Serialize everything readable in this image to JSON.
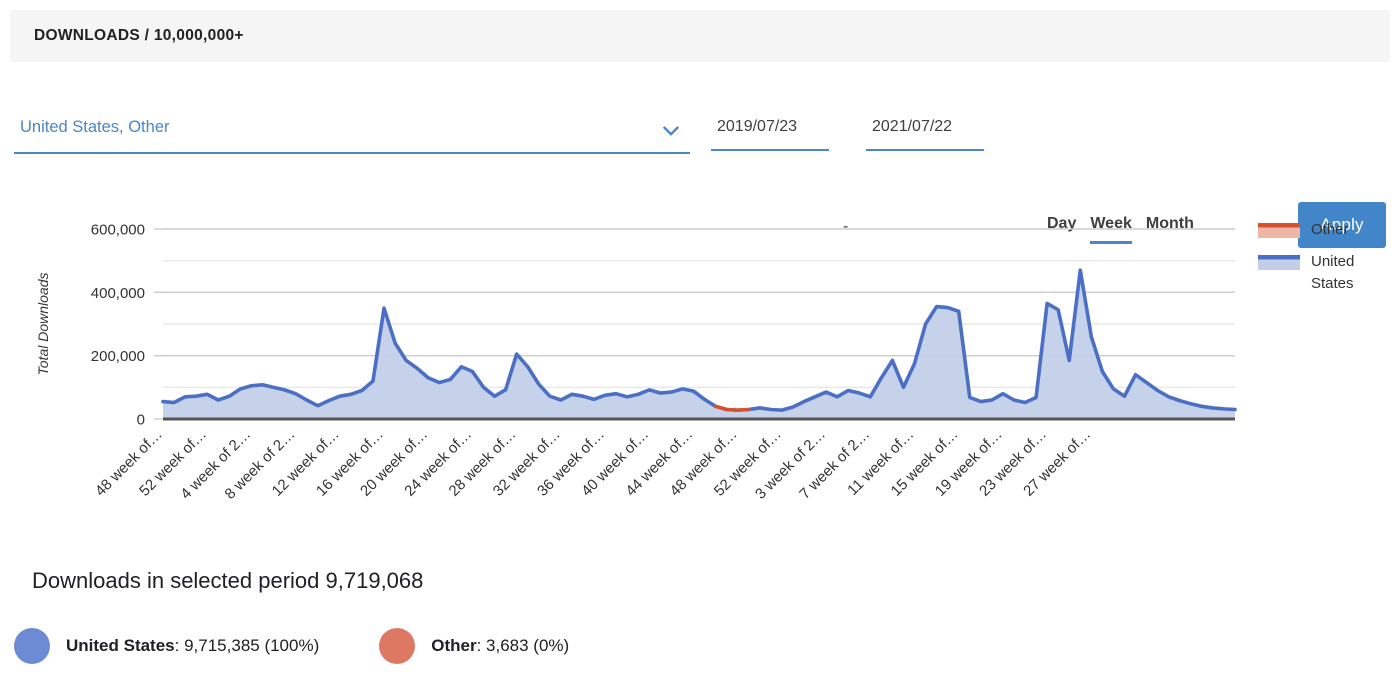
{
  "header": {
    "title": "DOWNLOADS / 10,000,000+"
  },
  "controls": {
    "country_select": {
      "value": "United States,  Other",
      "icon": "chevron-down-icon"
    },
    "date_start": "2019/07/23",
    "date_separator": "-",
    "date_end": "2021/07/22",
    "granularity": [
      {
        "label": "Day",
        "active": false
      },
      {
        "label": "Week",
        "active": true
      },
      {
        "label": "Month",
        "active": false
      }
    ],
    "apply_label": "Apply"
  },
  "colors": {
    "accent_blue": "#4285c8",
    "series_us_line": "#4a6fc4",
    "series_us_fill": "#c3cfe9",
    "series_other_line": "#d9512c",
    "series_other_fill": "#eeb6a6",
    "header_bg": "#f5f5f5",
    "summary_dot_us": "#6d8ad4",
    "summary_dot_other": "#dd7862"
  },
  "chart_data": {
    "type": "area",
    "title": "",
    "xlabel": "",
    "ylabel": "Total Downloads",
    "ylim": [
      0,
      600000
    ],
    "yticks": [
      0,
      200000,
      400000,
      600000
    ],
    "ytick_labels": [
      "0",
      "200,000",
      "400,000",
      "600,000"
    ],
    "gridlines_minor": [
      100000,
      300000,
      500000
    ],
    "grid": true,
    "legend_position": "right",
    "legend": [
      {
        "name": "Other",
        "line": "#d9512c",
        "fill": "#eeb6a6"
      },
      {
        "name": "United States",
        "line": "#4a6fc4",
        "fill": "#c3cfe9"
      }
    ],
    "xtick_labels": [
      "48 week of…",
      "52 week of…",
      "4 week of 2…",
      "8 week of 2…",
      "12 week of…",
      "16 week of…",
      "20 week of…",
      "24 week of…",
      "28 week of…",
      "32 week of…",
      "36 week of…",
      "40 week of…",
      "44 week of…",
      "48 week of…",
      "52 week of…",
      "3 week of 2…",
      "7 week of 2…",
      "11 week of…",
      "15 week of…",
      "19 week of…",
      "23 week of…",
      "27 week of…"
    ],
    "xtick_indices": [
      0,
      4,
      8,
      12,
      16,
      20,
      24,
      28,
      32,
      36,
      40,
      44,
      48,
      52,
      56,
      60,
      64,
      68,
      72,
      76,
      80,
      84
    ],
    "series": [
      {
        "name": "United States",
        "values": [
          55000,
          52000,
          70000,
          72000,
          78000,
          60000,
          72000,
          95000,
          105000,
          108000,
          100000,
          92000,
          80000,
          60000,
          42000,
          58000,
          72000,
          78000,
          90000,
          120000,
          350000,
          240000,
          185000,
          160000,
          130000,
          115000,
          125000,
          165000,
          150000,
          100000,
          72000,
          92000,
          205000,
          165000,
          110000,
          72000,
          60000,
          78000,
          72000,
          62000,
          75000,
          80000,
          70000,
          78000,
          92000,
          82000,
          85000,
          95000,
          88000,
          62000,
          40000,
          30000,
          28000,
          30000,
          35000,
          30000,
          28000,
          38000,
          55000,
          70000,
          85000,
          70000,
          90000,
          82000,
          70000,
          130000,
          185000,
          100000,
          175000,
          300000,
          355000,
          352000,
          340000,
          68000,
          55000,
          60000,
          80000,
          60000,
          52000,
          68000,
          365000,
          345000,
          185000,
          470000,
          260000,
          150000,
          95000,
          72000,
          140000,
          115000,
          90000,
          70000,
          58000,
          48000,
          40000,
          35000,
          32000,
          30000
        ]
      },
      {
        "name": "Other",
        "highlight_range": [
          50,
          53
        ],
        "values": [
          0,
          0,
          0,
          0,
          0,
          0,
          0,
          0,
          0,
          0,
          0,
          0,
          0,
          0,
          0,
          0,
          0,
          0,
          0,
          0,
          0,
          0,
          0,
          0,
          0,
          0,
          0,
          0,
          0,
          0,
          0,
          0,
          0,
          0,
          0,
          0,
          0,
          0,
          0,
          0,
          0,
          0,
          0,
          0,
          0,
          0,
          0,
          0,
          0,
          0,
          40000,
          30000,
          28000,
          30000,
          0,
          0,
          0,
          0,
          0,
          0,
          0,
          0,
          0,
          0,
          0,
          0,
          0,
          0,
          0,
          0,
          0,
          0,
          0,
          0,
          0,
          0,
          0,
          0,
          0,
          0,
          0,
          0,
          0,
          0,
          0,
          0,
          0,
          0,
          0,
          0,
          0,
          0,
          0,
          0,
          0,
          0,
          0,
          0,
          0,
          0
        ]
      }
    ]
  },
  "summary": {
    "title": "Downloads in selected period 9,719,068",
    "items": [
      {
        "name": "United States",
        "value": "9,715,385 (100%)",
        "color": "#6d8ad4"
      },
      {
        "name": "Other",
        "value": "3,683 (0%)",
        "color": "#dd7862"
      }
    ]
  }
}
